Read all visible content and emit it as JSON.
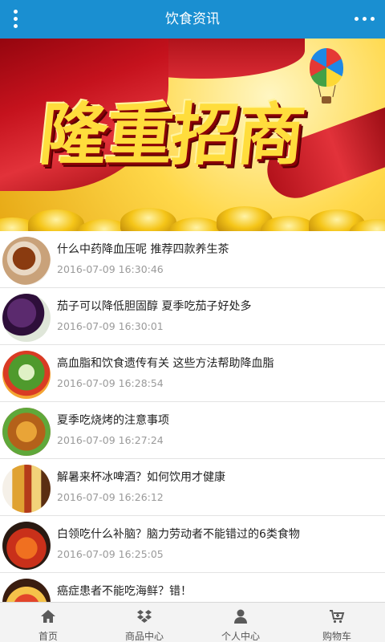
{
  "header": {
    "title": "饮食资讯",
    "menu_icon": "vertical-dots-icon",
    "more_icon": "horizontal-dots-icon",
    "color": "#1a8fd1"
  },
  "banner": {
    "headline": "隆重招商"
  },
  "news": [
    {
      "title": "什么中药降血压呢 推荐四款养生茶",
      "date": "2016-07-09 16:30:46",
      "thumb": "tea-cup-image"
    },
    {
      "title": "茄子可以降低胆固醇 夏季吃茄子好处多",
      "date": "2016-07-09 16:30:01",
      "thumb": "eggplant-image"
    },
    {
      "title": "高血脂和饮食遗传有关 这些方法帮助降血脂",
      "date": "2016-07-09 16:28:54",
      "thumb": "vegetables-image"
    },
    {
      "title": "夏季吃烧烤的注意事项",
      "date": "2016-07-09 16:27:24",
      "thumb": "barbecue-image"
    },
    {
      "title": "解暑来杯冰啤酒？如何饮用才健康",
      "date": "2016-07-09 16:26:12",
      "thumb": "beer-image"
    },
    {
      "title": "白领吃什么补脑？脑力劳动者不能错过的6类食物",
      "date": "2016-07-09 16:25:05",
      "thumb": "crawfish-image"
    },
    {
      "title": "癌症患者不能吃海鲜？错！",
      "date": "",
      "thumb": "seafood-image"
    }
  ],
  "tabbar": [
    {
      "label": "首页",
      "icon": "home-icon"
    },
    {
      "label": "商品中心",
      "icon": "dropbox-icon"
    },
    {
      "label": "个人中心",
      "icon": "user-icon"
    },
    {
      "label": "购物车",
      "icon": "cart-icon"
    }
  ]
}
